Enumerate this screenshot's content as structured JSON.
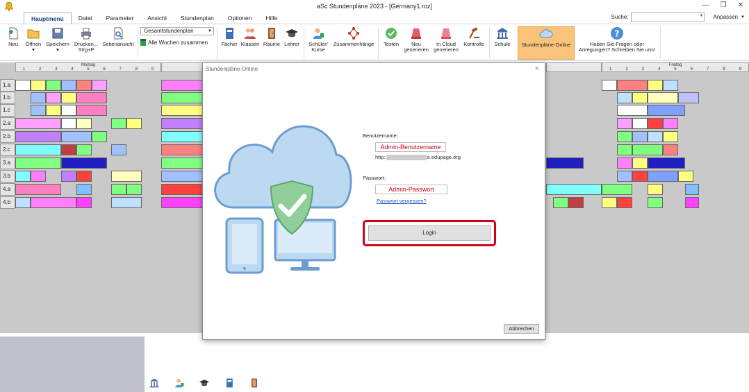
{
  "window": {
    "title": "aSc Stundenpläne 2023 - [Germany1.roz]",
    "controls": [
      "—",
      "❐",
      "✕"
    ]
  },
  "menu": {
    "tabs": [
      "Hauptmenü",
      "Datei",
      "Parameter",
      "Ansicht",
      "Stundenplan",
      "Optionen",
      "Hilfe"
    ]
  },
  "search": {
    "label": "Suche:",
    "customize": "Anpassen"
  },
  "ribbon": {
    "new": "Neu",
    "open": "Öffnen",
    "save": "Speichern",
    "print": "Drucken...",
    "print_sub": "Strg+P",
    "preview": "Seitenansicht",
    "combo_value": "Gesamtstundenplan",
    "weeks": "Alle Wochen zusammen",
    "subjects": "Fächer",
    "classes": "Klassen",
    "rooms": "Räume",
    "teachers": "Lehrer",
    "students": "Schüler/",
    "students_sub": "Kurse",
    "relations": "Zusammenhänge",
    "test": "Testen",
    "generate": "Neu",
    "generate_sub": "generieren",
    "cloud": "In Cloud",
    "cloud_sub": "generieren",
    "check": "Kontrolle",
    "school": "Schule",
    "online": "Stundenpläne-Online",
    "feedback": "Haben Sie Fragen oder",
    "feedback_sub": "Anregungen? Schreiben Sie uns!"
  },
  "grid": {
    "day1": "Montag",
    "day5": "Freitag",
    "periods": [
      "1",
      "2",
      "3",
      "4",
      "5",
      "6",
      "7",
      "8",
      "9"
    ],
    "rows": [
      "1.a",
      "1.b",
      "1.c",
      "2.a",
      "2.b",
      "2.c",
      "3.a",
      "3.b",
      "4.a",
      "4.b"
    ]
  },
  "dialog": {
    "title": "Stundenpläne-Online",
    "username_label": "Benutzername:",
    "username_value": "Admin-Benutzername",
    "url_prefix": "http:",
    "url_suffix": "e.edupage.org",
    "password_label": "Passwort:",
    "password_value": "Admin-Passwort",
    "forgot": "Passwort vergessen?",
    "login": "Login",
    "cancel": "Abbrechen",
    "close": "×"
  },
  "colors": {
    "accent": "#f9c47a",
    "login_highlight": "#d0021b",
    "cloud": "#bcd9f2",
    "shield": "#8fcf9a"
  }
}
